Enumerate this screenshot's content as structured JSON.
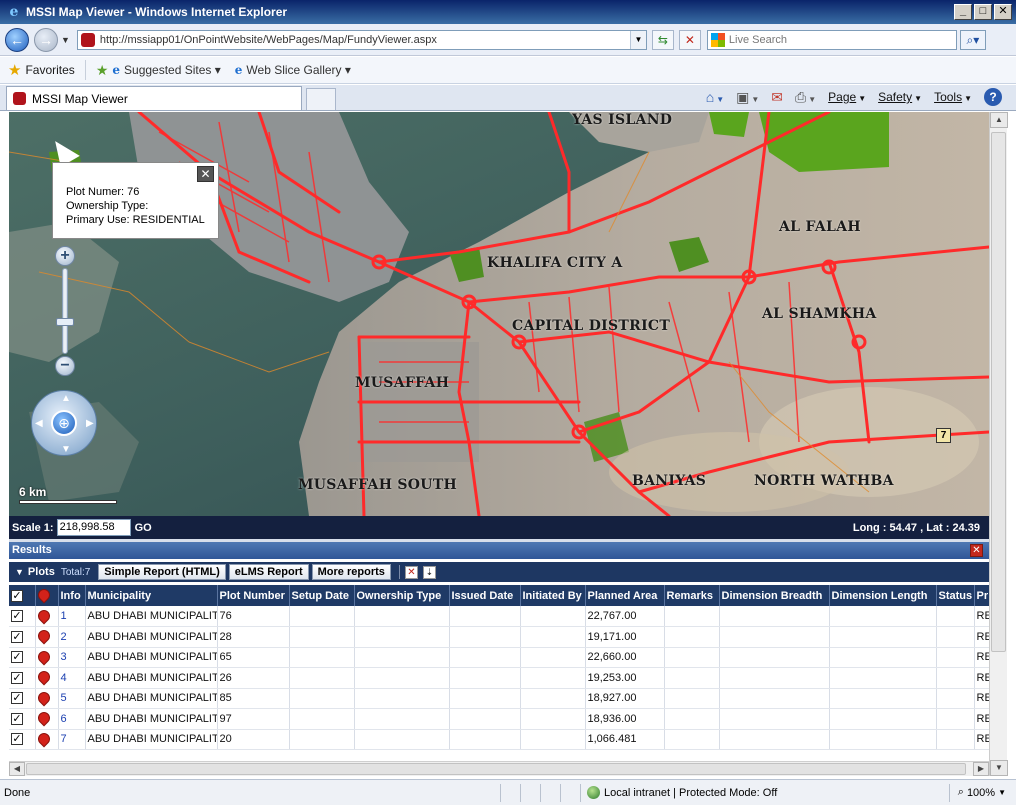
{
  "window": {
    "title": "MSSI Map Viewer - Windows Internet Explorer",
    "buttons": [
      "_",
      "□",
      "✕"
    ]
  },
  "address_bar": {
    "url": "http://mssiapp01/OnPointWebsite/WebPages/Map/FundyViewer.aspx",
    "search_placeholder": "Live Search"
  },
  "favorites_bar": {
    "favorites_label": "Favorites",
    "items": [
      "Suggested Sites ▾",
      "Web Slice Gallery ▾"
    ]
  },
  "tab": {
    "title": "MSSI Map Viewer"
  },
  "command_bar": {
    "page": "Page",
    "safety": "Safety",
    "tools": "Tools"
  },
  "map": {
    "labels": [
      {
        "text": "YAS ISLAND"
      },
      {
        "text": "AL FALAH"
      },
      {
        "text": "KHALIFA CITY A"
      },
      {
        "text": "CAPITAL DISTRICT"
      },
      {
        "text": "AL SHAMKHA"
      },
      {
        "text": "MUSAFFAH"
      },
      {
        "text": "MUSAFFAH SOUTH"
      },
      {
        "text": "BANIYAS"
      },
      {
        "text": "NORTH WATHBA"
      }
    ],
    "popup": {
      "lines": [
        "Plot Numer: 76",
        "Ownership Type:",
        "Primary Use: RESIDENTIAL"
      ]
    },
    "scale_bar_text": "6 km",
    "marker_label": "7",
    "zoom_controls": {
      "plus": "+",
      "minus": "−"
    }
  },
  "scale_strip": {
    "scale_label": "Scale 1:",
    "scale_value": "218,998.58",
    "go_label": "GO",
    "coords": "Long : 54.47 , Lat : 24.39"
  },
  "results": {
    "title": "Results",
    "plots_title": "Plots",
    "plots_total": "Total:7",
    "buttons": {
      "simple_report": "Simple Report (HTML)",
      "elms_report": "eLMS Report",
      "more_reports": "More reports"
    },
    "columns": [
      "Info",
      "Municipality",
      "Plot Number",
      "Setup Date",
      "Ownership Type",
      "Issued Date",
      "Initiated By",
      "Planned Area",
      "Remarks",
      "Dimension Breadth",
      "Dimension Length",
      "Status",
      "Pr"
    ],
    "rows": [
      {
        "info": "1",
        "municipality": "ABU DHABI MUNICIPALITY",
        "plot_number": "76",
        "setup_date": "",
        "ownership_type": "",
        "issued_date": "",
        "initiated_by": "",
        "planned_area": "22,767.00",
        "remarks": "",
        "dimension_breadth": "",
        "dimension_length": "",
        "status": "",
        "pr": "RE"
      },
      {
        "info": "2",
        "municipality": "ABU DHABI MUNICIPALITY",
        "plot_number": "28",
        "setup_date": "",
        "ownership_type": "",
        "issued_date": "",
        "initiated_by": "",
        "planned_area": "19,171.00",
        "remarks": "",
        "dimension_breadth": "",
        "dimension_length": "",
        "status": "",
        "pr": "RE"
      },
      {
        "info": "3",
        "municipality": "ABU DHABI MUNICIPALITY",
        "plot_number": "65",
        "setup_date": "",
        "ownership_type": "",
        "issued_date": "",
        "initiated_by": "",
        "planned_area": "22,660.00",
        "remarks": "",
        "dimension_breadth": "",
        "dimension_length": "",
        "status": "",
        "pr": "RE"
      },
      {
        "info": "4",
        "municipality": "ABU DHABI MUNICIPALITY",
        "plot_number": "26",
        "setup_date": "",
        "ownership_type": "",
        "issued_date": "",
        "initiated_by": "",
        "planned_area": "19,253.00",
        "remarks": "",
        "dimension_breadth": "",
        "dimension_length": "",
        "status": "",
        "pr": "RE"
      },
      {
        "info": "5",
        "municipality": "ABU DHABI MUNICIPALITY",
        "plot_number": "85",
        "setup_date": "",
        "ownership_type": "",
        "issued_date": "",
        "initiated_by": "",
        "planned_area": "18,927.00",
        "remarks": "",
        "dimension_breadth": "",
        "dimension_length": "",
        "status": "",
        "pr": "RE"
      },
      {
        "info": "6",
        "municipality": "ABU DHABI MUNICIPALITY",
        "plot_number": "97",
        "setup_date": "",
        "ownership_type": "",
        "issued_date": "",
        "initiated_by": "",
        "planned_area": "18,936.00",
        "remarks": "",
        "dimension_breadth": "",
        "dimension_length": "",
        "status": "",
        "pr": "RE"
      },
      {
        "info": "7",
        "municipality": "ABU DHABI MUNICIPALITY",
        "plot_number": "20",
        "setup_date": "",
        "ownership_type": "",
        "issued_date": "",
        "initiated_by": "",
        "planned_area": "1,066.481",
        "remarks": "",
        "dimension_breadth": "",
        "dimension_length": "",
        "status": "",
        "pr": "RE"
      }
    ]
  },
  "status_bar": {
    "status": "Done",
    "zone": "Local intranet | Protected Mode: Off",
    "zoom": "100%"
  },
  "icons": {
    "back": "back-arrow-icon",
    "forward": "forward-arrow-icon",
    "refresh": "refresh-icon",
    "stop": "stop-icon",
    "search": "search-icon",
    "home": "home-icon",
    "feeds": "rss-feed-icon",
    "mail": "mail-icon",
    "print": "printer-icon",
    "help": "help-icon"
  },
  "colors": {
    "road": "#ff2a2a",
    "vegetation": "#5aa51e",
    "header_blue": "#1f3a66",
    "results_bar": "#3a63a6"
  }
}
